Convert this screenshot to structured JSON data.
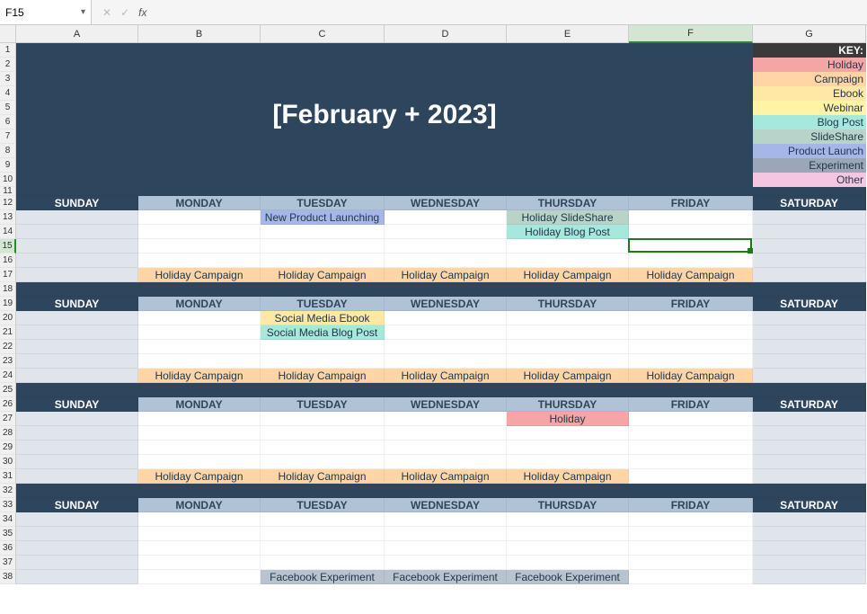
{
  "formula_bar": {
    "name_box": "F15",
    "fx_label": "fx",
    "cancel_glyph": "✕",
    "accept_glyph": "✓",
    "down_glyph": "▾",
    "formula": ""
  },
  "columns": [
    "A",
    "B",
    "C",
    "D",
    "E",
    "F",
    "G"
  ],
  "col_widths": {
    "A": 136,
    "B": 136,
    "C": 138,
    "D": 136,
    "E": 136,
    "F": 138,
    "G": 126
  },
  "selected_col": "F",
  "row_count": 38,
  "row_heights": {
    "default": 16,
    "11": 10
  },
  "selected_row": 15,
  "title": "[February + 2023]",
  "key": {
    "header": "KEY:",
    "items": [
      {
        "label": "Holiday",
        "bg": "#f4a6a6"
      },
      {
        "label": "Campaign",
        "bg": "#ffd5a6"
      },
      {
        "label": "Ebook",
        "bg": "#ffe8a6"
      },
      {
        "label": "Webinar",
        "bg": "#fff4a6"
      },
      {
        "label": "Blog Post",
        "bg": "#a6e8dc"
      },
      {
        "label": "SlideShare",
        "bg": "#b8d4c8"
      },
      {
        "label": "Product Launch",
        "bg": "#a6b6e8"
      },
      {
        "label": "Experiment",
        "bg": "#9ba6b8"
      },
      {
        "label": "Other",
        "bg": "#f4c6e0"
      }
    ]
  },
  "gap_rows": [
    11,
    18,
    25,
    32
  ],
  "day_header_rows": [
    12,
    19,
    26,
    33
  ],
  "days": [
    "SUNDAY",
    "MONDAY",
    "TUESDAY",
    "WEDNESDAY",
    "THURSDAY",
    "FRIDAY",
    "SATURDAY"
  ],
  "weekend_cols": [
    "A",
    "G"
  ],
  "palette": {
    "holiday": "#f4a6a6",
    "campaign": "#ffd5a6",
    "ebook": "#ffe8a6",
    "webinar": "#fff4a6",
    "blog": "#a6e8dc",
    "slide": "#b8d4c8",
    "launch": "#a6b6e8",
    "experiment": "#b9c2cf",
    "other": "#f4c6e0",
    "banner": "#2e465d",
    "weekday_bg": "#ffffff",
    "weekend_bg": "#dfe5eb",
    "text": "#23374a"
  },
  "events": [
    {
      "row": 13,
      "col": "C",
      "text": "New Product Launching",
      "kind": "launch"
    },
    {
      "row": 13,
      "col": "E",
      "text": "Holiday SlideShare",
      "kind": "slide"
    },
    {
      "row": 14,
      "col": "E",
      "text": "Holiday Blog Post",
      "kind": "blog"
    },
    {
      "row": 17,
      "col": "B",
      "text": "Holiday Campaign",
      "kind": "campaign"
    },
    {
      "row": 17,
      "col": "C",
      "text": "Holiday Campaign",
      "kind": "campaign"
    },
    {
      "row": 17,
      "col": "D",
      "text": "Holiday Campaign",
      "kind": "campaign"
    },
    {
      "row": 17,
      "col": "E",
      "text": "Holiday Campaign",
      "kind": "campaign"
    },
    {
      "row": 17,
      "col": "F",
      "text": "Holiday Campaign",
      "kind": "campaign"
    },
    {
      "row": 20,
      "col": "C",
      "text": "Social Media Ebook",
      "kind": "ebook"
    },
    {
      "row": 21,
      "col": "C",
      "text": "Social Media Blog Post",
      "kind": "blog"
    },
    {
      "row": 24,
      "col": "B",
      "text": "Holiday Campaign",
      "kind": "campaign"
    },
    {
      "row": 24,
      "col": "C",
      "text": "Holiday Campaign",
      "kind": "campaign"
    },
    {
      "row": 24,
      "col": "D",
      "text": "Holiday Campaign",
      "kind": "campaign"
    },
    {
      "row": 24,
      "col": "E",
      "text": "Holiday Campaign",
      "kind": "campaign"
    },
    {
      "row": 24,
      "col": "F",
      "text": "Holiday Campaign",
      "kind": "campaign"
    },
    {
      "row": 27,
      "col": "E",
      "text": "Holiday",
      "kind": "holiday"
    },
    {
      "row": 31,
      "col": "B",
      "text": "Holiday Campaign",
      "kind": "campaign"
    },
    {
      "row": 31,
      "col": "C",
      "text": "Holiday Campaign",
      "kind": "campaign"
    },
    {
      "row": 31,
      "col": "D",
      "text": "Holiday Campaign",
      "kind": "campaign"
    },
    {
      "row": 31,
      "col": "E",
      "text": "Holiday Campaign",
      "kind": "campaign"
    },
    {
      "row": 38,
      "col": "C",
      "text": "Facebook Experiment",
      "kind": "experiment"
    },
    {
      "row": 38,
      "col": "D",
      "text": "Facebook Experiment",
      "kind": "experiment"
    },
    {
      "row": 38,
      "col": "E",
      "text": "Facebook Experiment",
      "kind": "experiment"
    }
  ]
}
